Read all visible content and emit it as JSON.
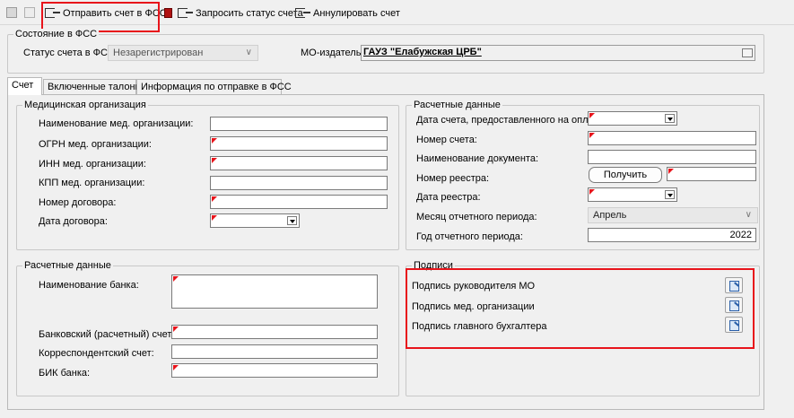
{
  "toolbar": {
    "send_label": "Отправить счет в ФСС",
    "request_label": "Запросить статус счета",
    "cancel_label": "Аннулировать счет"
  },
  "state_group": {
    "title": "Состояние в ФСС",
    "status_label": "Статус счета в ФСС",
    "status_value": "Незарегистрирован",
    "mo_label": "МО-издатель:",
    "mo_value": "ГАУЗ \"Елабужская ЦРБ\""
  },
  "tabs": [
    {
      "label": "Счет"
    },
    {
      "label": "Включенные талоны"
    },
    {
      "label": "Информация по отправке в ФСС"
    }
  ],
  "med_org": {
    "title": "Медицинская организация",
    "fields": [
      {
        "label": "Наименование  мед. организации:"
      },
      {
        "label": "ОГРН мед. организации:"
      },
      {
        "label": "ИНН мед. организации:"
      },
      {
        "label": "КПП мед. организации:"
      },
      {
        "label": "Номер договора:"
      },
      {
        "label": "Дата договора:"
      }
    ]
  },
  "calc_right": {
    "title": "Расчетные данные",
    "fields": [
      {
        "label": "Дата счета, предоставленного на оплату:"
      },
      {
        "label": "Номер счета:"
      },
      {
        "label": "Наименование документа:"
      },
      {
        "label": "Номер реестра:"
      },
      {
        "label": "Дата реестра:"
      },
      {
        "label": "Месяц отчетного периода:"
      },
      {
        "label": "Год отчетного периода:"
      }
    ],
    "get_button": "Получить",
    "month_value": "Апрель",
    "year_value": "2022"
  },
  "calc_left": {
    "title": "Расчетные данные",
    "fields": [
      {
        "label": "Наименование банка:"
      },
      {
        "label": "Банковский (расчетный) счет:"
      },
      {
        "label": "Корреспондентский счет:"
      },
      {
        "label": "БИК банка:"
      }
    ]
  },
  "signatures": {
    "title": "Подписи",
    "items": [
      {
        "label": "Подпись руководителя МО"
      },
      {
        "label": "Подпись мед. организации"
      },
      {
        "label": "Подпись главного бухгалтера"
      }
    ]
  },
  "colors": {
    "highlight": "#e8141b",
    "required_marker": "#e8141b"
  }
}
